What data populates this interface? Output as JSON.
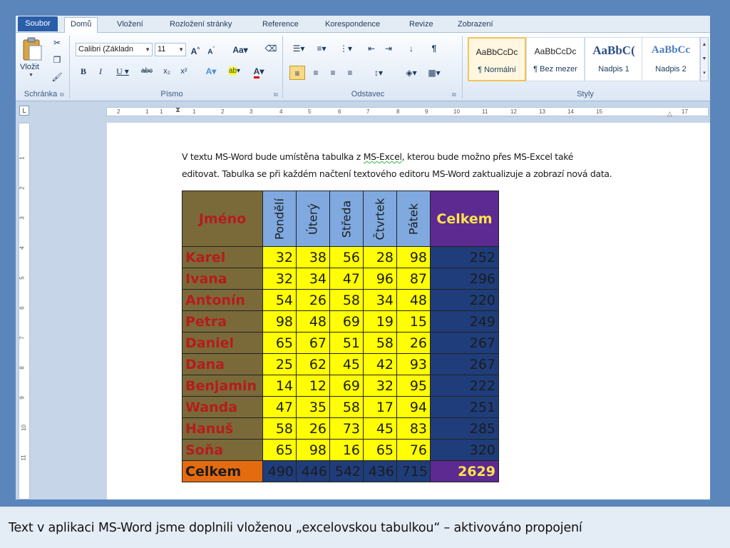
{
  "ribbon": {
    "tabs": [
      "Soubor",
      "Domů",
      "Vložení",
      "Rozložení stránky",
      "Reference",
      "Korespondence",
      "Revize",
      "Zobrazení"
    ],
    "clipboard": {
      "paste_label": "Vložit",
      "group_label": "Schránka"
    },
    "font": {
      "name": "Calibri (Základn",
      "size": "11",
      "group_label": "Písmo"
    },
    "paragraph": {
      "group_label": "Odstavec"
    },
    "styles": {
      "group_label": "Styly",
      "items": [
        {
          "preview": "AaBbCcDc",
          "name": "¶ Normální"
        },
        {
          "preview": "AaBbCcDc",
          "name": "¶ Bez mezer"
        },
        {
          "preview": "AaBbC(",
          "name": "Nadpis 1"
        },
        {
          "preview": "AaBbCc",
          "name": "Nadpis 2"
        }
      ]
    }
  },
  "ruler_ticks": [
    "2",
    "1",
    "1",
    "1",
    "2",
    "3",
    "4",
    "5",
    "6",
    "7",
    "8",
    "9",
    "10",
    "11",
    "12",
    "13",
    "14",
    "15",
    "17"
  ],
  "vruler_ticks": [
    "1",
    "2",
    "3",
    "4",
    "5",
    "6",
    "7",
    "8",
    "9",
    "10",
    "11"
  ],
  "document": {
    "line1_pre": "V textu MS-Word bude umístěna tabulka z ",
    "line1_link": "MS-Excel",
    "line1_post": ", kterou bude možno přes MS-Excel také",
    "line2": "editovat. Tabulka se při každém načtení textového editoru MS-Word zaktualizuje a zobrazí nová data."
  },
  "table": {
    "header_name": "Jméno",
    "days": [
      "Pondělí",
      "Úterý",
      "Středa",
      "Čtvrtek",
      "Pátek"
    ],
    "header_total": "Celkem",
    "rows": [
      {
        "name": "Karel",
        "values": [
          "32",
          "38",
          "56",
          "28",
          "98"
        ],
        "total": "252"
      },
      {
        "name": "Ivana",
        "values": [
          "32",
          "34",
          "47",
          "96",
          "87"
        ],
        "total": "296"
      },
      {
        "name": "Antonín",
        "values": [
          "54",
          "26",
          "58",
          "34",
          "48"
        ],
        "total": "220"
      },
      {
        "name": "Petra",
        "values": [
          "98",
          "48",
          "69",
          "19",
          "15"
        ],
        "total": "249"
      },
      {
        "name": "Daniel",
        "values": [
          "65",
          "67",
          "51",
          "58",
          "26"
        ],
        "total": "267"
      },
      {
        "name": "Dana",
        "values": [
          "25",
          "62",
          "45",
          "42",
          "93"
        ],
        "total": "267"
      },
      {
        "name": "Benjamin",
        "values": [
          "14",
          "12",
          "69",
          "32",
          "95"
        ],
        "total": "222"
      },
      {
        "name": "Wanda",
        "values": [
          "47",
          "35",
          "58",
          "17",
          "94"
        ],
        "total": "251"
      },
      {
        "name": "Hanuš",
        "values": [
          "58",
          "26",
          "73",
          "45",
          "83"
        ],
        "total": "285"
      },
      {
        "name": "Soňa",
        "values": [
          "65",
          "98",
          "16",
          "65",
          "76"
        ],
        "total": "320"
      }
    ],
    "footer_label": "Celkem",
    "footer_values": [
      "490",
      "446",
      "542",
      "436",
      "715"
    ],
    "footer_total": "2629"
  },
  "caption": "Text v aplikaci MS-Word jsme doplnili vloženou „excelovskou tabulkou“ –  aktivováno propojení"
}
